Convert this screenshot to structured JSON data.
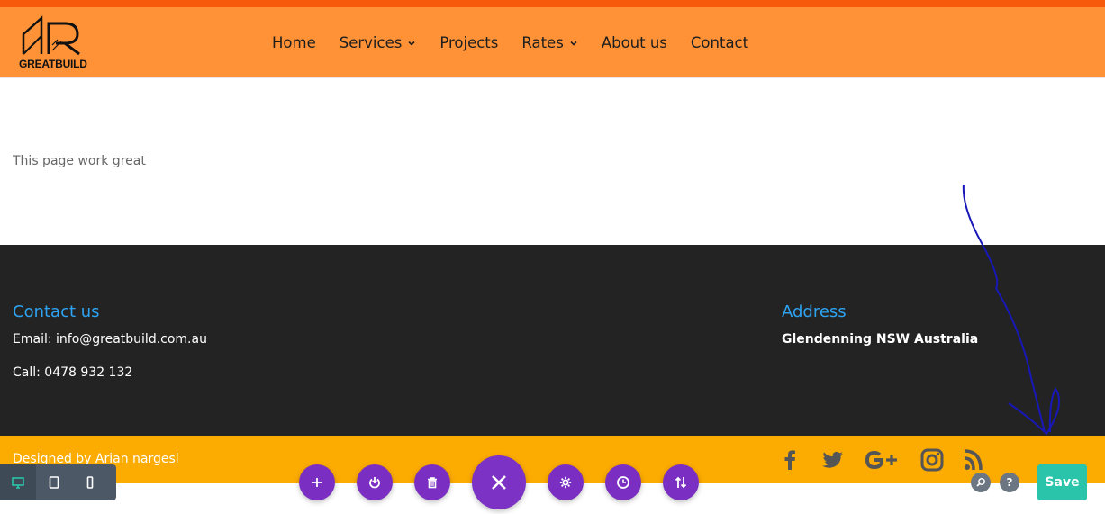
{
  "brand": {
    "logo_text": "GREATBUILD"
  },
  "nav": {
    "home": "Home",
    "services": "Services",
    "projects": "Projects",
    "rates": "Rates",
    "about": "About us",
    "contact": "Contact"
  },
  "content": {
    "text": "This page work great"
  },
  "footer": {
    "contact_heading": "Contact us",
    "email": "Email: info@greatbuild.com.au",
    "call": "Call: 0478 932 132",
    "address_heading": "Address",
    "address": "Glendenning NSW Australia"
  },
  "bottom": {
    "designed_by": "Designed by Arian nargesi",
    "social_icons": [
      "facebook-icon",
      "twitter-icon",
      "google-plus-icon",
      "instagram-icon",
      "rss-icon"
    ]
  },
  "builder": {
    "save_label": "Save",
    "help_label": "?",
    "view_modes": [
      "desktop-icon",
      "tablet-icon",
      "phone-icon"
    ],
    "actions": [
      "plus-icon",
      "power-icon",
      "trash-icon",
      "close-icon",
      "gear-icon",
      "clock-icon",
      "sort-icon"
    ]
  },
  "colors": {
    "header": "#ff9236",
    "top_strip": "#f85a0c",
    "footer": "#232323",
    "bottom_bar": "#fcab00",
    "accent_link": "#2ea3f2",
    "builder_purple": "#7a2fc2",
    "save_green": "#29c4a9"
  }
}
